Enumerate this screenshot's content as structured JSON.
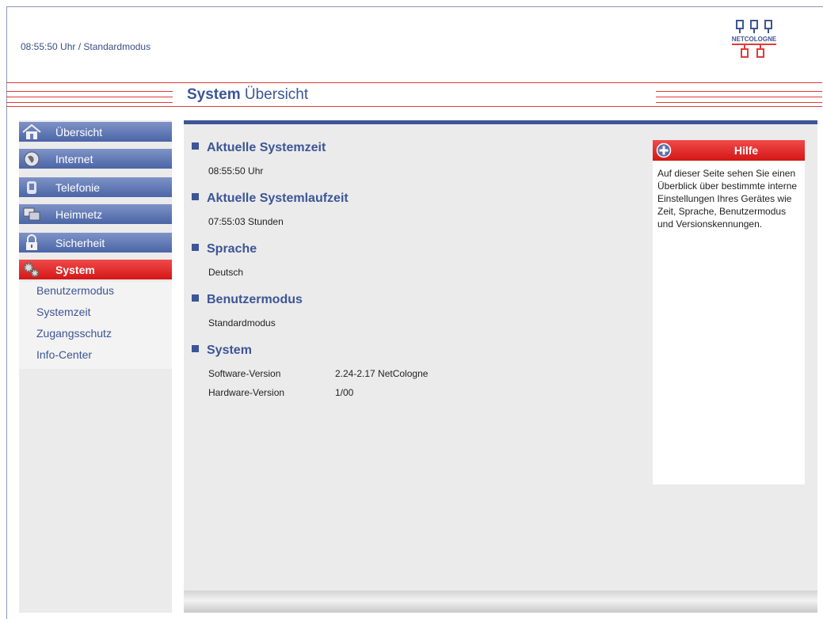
{
  "header": {
    "status": "08:55:50 Uhr  / Standardmodus",
    "logo_text": "NETCOLOGNE"
  },
  "title": {
    "bold": "System",
    "rest": " Übersicht"
  },
  "nav": {
    "items": [
      {
        "label": "Übersicht",
        "icon": "house-icon"
      },
      {
        "label": "Internet",
        "icon": "globe-icon"
      },
      {
        "label": "Telefonie",
        "icon": "phone-icon"
      },
      {
        "label": "Heimnetz",
        "icon": "monitors-icon"
      },
      {
        "label": "Sicherheit",
        "icon": "lock-icon"
      },
      {
        "label": "System",
        "icon": "gears-icon",
        "active": true
      }
    ],
    "subitems": [
      "Benutzermodus",
      "Systemzeit",
      "Zugangsschutz",
      "Info-Center"
    ]
  },
  "sections": {
    "systemzeit": {
      "heading": "Aktuelle Systemzeit",
      "value": "08:55:50 Uhr"
    },
    "laufzeit": {
      "heading": "Aktuelle Systemlaufzeit",
      "value": "07:55:03 Stunden"
    },
    "sprache": {
      "heading": "Sprache",
      "value": "Deutsch"
    },
    "benutzermodus": {
      "heading": "Benutzermodus",
      "value": "Standardmodus"
    },
    "system": {
      "heading": "System",
      "software_label": "Software-Version",
      "software_value": "2.24-2.17 NetCologne",
      "hardware_label": "Hardware-Version",
      "hardware_value": "1/00"
    }
  },
  "help": {
    "title": "Hilfe",
    "text": "Auf dieser Seite sehen Sie einen Überblick über bestimmte interne Einstellungen Ihres Gerätes wie Zeit, Sprache, Benutzermodus und Versionskennungen."
  },
  "colors": {
    "accent_blue": "#3c5596",
    "accent_red": "#e23a3a"
  }
}
